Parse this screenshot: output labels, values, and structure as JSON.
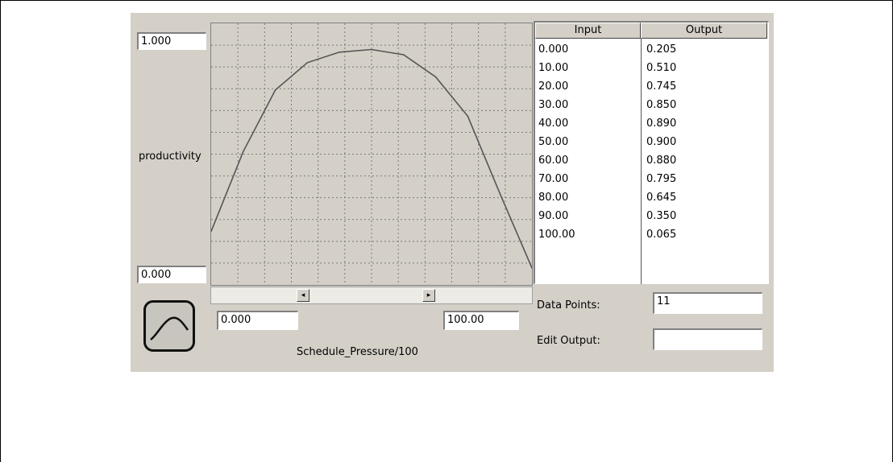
{
  "graph": {
    "y_max": "1.000",
    "y_min": "0.000",
    "y_label": "productivity",
    "x_min": "0.000",
    "x_max": "100.00",
    "x_label": "Schedule_Pressure/100",
    "scroll_left_glyph": "◂",
    "scroll_right_glyph": "▸",
    "graph_type_icon": "curve-icon"
  },
  "table": {
    "headers": {
      "input": "Input",
      "output": "Output"
    },
    "rows": [
      {
        "input": "0.000",
        "output": "0.205"
      },
      {
        "input": "10.00",
        "output": "0.510"
      },
      {
        "input": "20.00",
        "output": "0.745"
      },
      {
        "input": "30.00",
        "output": "0.850"
      },
      {
        "input": "40.00",
        "output": "0.890"
      },
      {
        "input": "50.00",
        "output": "0.900"
      },
      {
        "input": "60.00",
        "output": "0.880"
      },
      {
        "input": "70.00",
        "output": "0.795"
      },
      {
        "input": "80.00",
        "output": "0.645"
      },
      {
        "input": "90.00",
        "output": "0.350"
      },
      {
        "input": "100.00",
        "output": "0.065"
      }
    ]
  },
  "controls": {
    "data_points_label": "Data Points:",
    "data_points_value": "11",
    "edit_output_label": "Edit Output:",
    "edit_output_value": ""
  },
  "chart_data": {
    "type": "line",
    "x": [
      0,
      10,
      20,
      30,
      40,
      50,
      60,
      70,
      80,
      90,
      100
    ],
    "series": [
      {
        "values": [
          0.205,
          0.51,
          0.745,
          0.85,
          0.89,
          0.9,
          0.88,
          0.795,
          0.645,
          0.35,
          0.065
        ]
      }
    ],
    "xlabel": "Schedule_Pressure/100",
    "ylabel": "productivity",
    "xlim": [
      0,
      100
    ],
    "ylim": [
      0,
      1
    ],
    "grid": true,
    "colors": {
      "line": "#555555",
      "grid": "#7a7a7a",
      "background": "#d4d0c8"
    }
  }
}
